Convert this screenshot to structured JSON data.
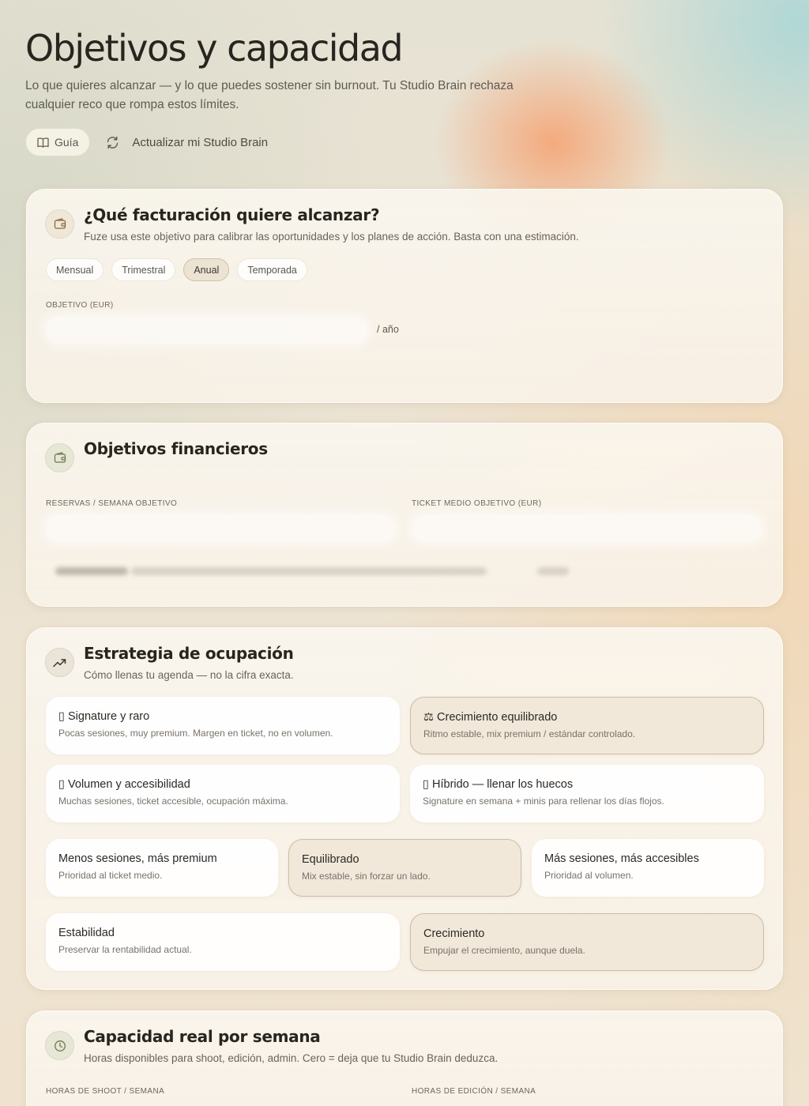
{
  "header": {
    "title": "Objetivos y capacidad",
    "subtitle": "Lo que quieres alcanzar — y lo que puedes sostener sin burnout. Tu Studio Brain rechaza cualquier reco que rompa estos límites.",
    "guide_label": "Guía",
    "refresh_label": "Actualizar mi Studio Brain"
  },
  "revenue": {
    "title": "¿Qué facturación quiere alcanzar?",
    "description": "Fuze usa este objetivo para calibrar las oportunidades y los planes de acción. Basta con una estimación.",
    "periods": [
      "Mensual",
      "Trimestral",
      "Anual",
      "Temporada"
    ],
    "selected_period": "Anual",
    "field_label": "OBJETIVO (EUR)",
    "field_value": "",
    "unit": "/ año"
  },
  "financial": {
    "title": "Objetivos financieros",
    "bookings_label": "RESERVAS / SEMANA OBJETIVO",
    "bookings_value": "",
    "ticket_label": "TICKET MEDIO OBJETIVO (EUR)",
    "ticket_value": ""
  },
  "strategy": {
    "title": "Estrategia de ocupación",
    "description": "Cómo llenas tu agenda — no la cifra exacta.",
    "modes": [
      {
        "title": "▯ Signature y raro",
        "desc": "Pocas sesiones, muy premium. Margen en ticket, no en volumen.",
        "active": false
      },
      {
        "title": "⚖ Crecimiento equilibrado",
        "desc": "Ritmo estable, mix premium / estándar controlado.",
        "active": true
      },
      {
        "title": "▯ Volumen y accesibilidad",
        "desc": "Muchas sesiones, ticket accesible, ocupación máxima.",
        "active": false
      },
      {
        "title": "▯ Híbrido — llenar los huecos",
        "desc": "Signature en semana + minis para rellenar los días flojos.",
        "active": false
      }
    ],
    "balance": [
      {
        "title": "Menos sesiones, más premium",
        "desc": "Prioridad al ticket medio.",
        "active": false
      },
      {
        "title": "Equilibrado",
        "desc": "Mix estable, sin forzar un lado.",
        "active": true
      },
      {
        "title": "Más sesiones, más accesibles",
        "desc": "Prioridad al volumen.",
        "active": false
      }
    ],
    "goal": [
      {
        "title": "Estabilidad",
        "desc": "Preservar la rentabilidad actual.",
        "active": false
      },
      {
        "title": "Crecimiento",
        "desc": "Empujar el crecimiento, aunque duela.",
        "active": true
      }
    ]
  },
  "capacity": {
    "title": "Capacidad real por semana",
    "description": "Horas disponibles para shoot, edición, admin. Cero = deja que tu Studio Brain deduzca.",
    "shoot_label": "HORAS DE SHOOT / SEMANA",
    "edit_label": "HORAS DE EDICIÓN / SEMANA"
  },
  "icons": {
    "guide": "book-open-icon",
    "refresh": "refresh-icon",
    "revenue": "wallet-icon",
    "financial": "wallet-icon",
    "strategy": "trending-up-icon",
    "capacity": "clock-icon"
  }
}
